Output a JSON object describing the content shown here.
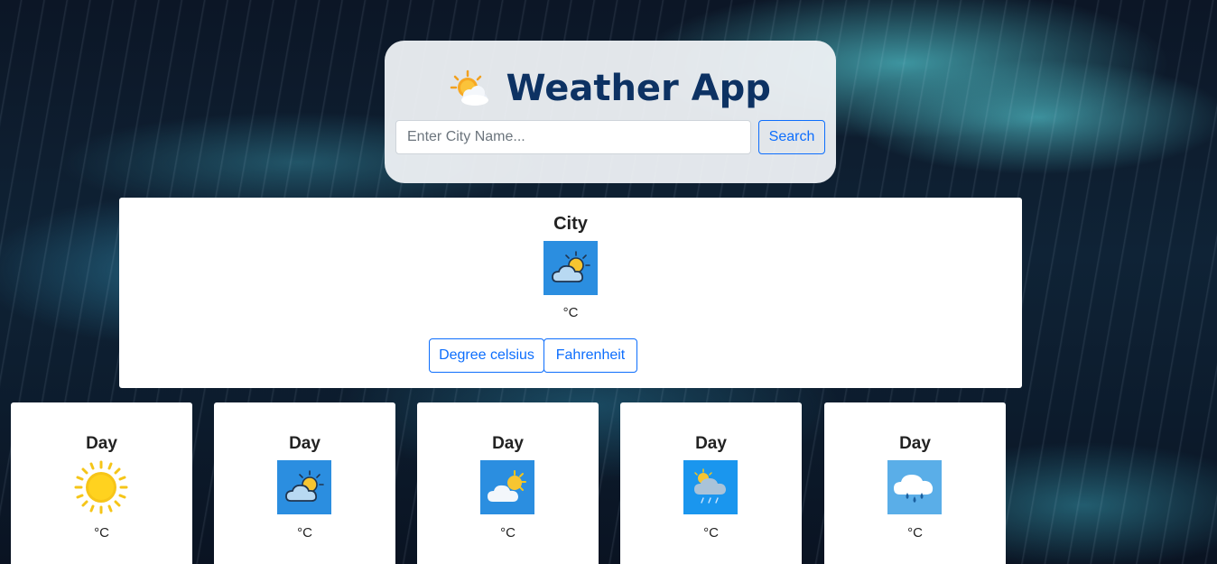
{
  "header": {
    "title": "Weather App",
    "title_icon": "sun-behind-cloud-icon"
  },
  "search": {
    "placeholder": "Enter City Name...",
    "value": "",
    "button_label": "Search"
  },
  "current": {
    "city": "City",
    "icon": "partly-cloudy-icon",
    "temperature": "°C",
    "units": {
      "celsius_label": "Degree celsius",
      "fahrenheit_label": "Fahrenheit"
    }
  },
  "forecast": [
    {
      "day": "Day",
      "icon": "sunny-icon",
      "temperature": "°C"
    },
    {
      "day": "Day",
      "icon": "partly-cloudy-icon",
      "temperature": "°C"
    },
    {
      "day": "Day",
      "icon": "cloud-sun-icon",
      "temperature": "°C"
    },
    {
      "day": "Day",
      "icon": "rain-cloud-icon",
      "temperature": "°C"
    },
    {
      "day": "Day",
      "icon": "heavy-rain-icon",
      "temperature": "°C"
    }
  ],
  "colors": {
    "title": "#0d3263",
    "accent": "#0d6efd",
    "icon_tile_blue": "#2b8ee0",
    "sun_yellow": "#f5c518"
  }
}
